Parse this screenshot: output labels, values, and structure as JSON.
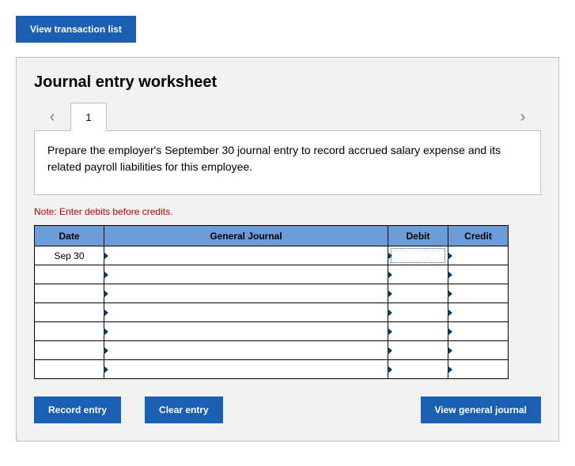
{
  "top_button": "View transaction list",
  "panel": {
    "title": "Journal entry worksheet",
    "tabs": [
      "1"
    ],
    "instruction": "Prepare the employer's September 30 journal entry to record accrued salary expense and its related payroll liabilities for this employee.",
    "note": "Note: Enter debits before credits."
  },
  "table": {
    "headers": {
      "date": "Date",
      "gj": "General Journal",
      "debit": "Debit",
      "credit": "Credit"
    },
    "rows": [
      {
        "date": "Sep 30",
        "gj": "",
        "debit": "",
        "credit": "",
        "focus": "debit"
      },
      {
        "date": "",
        "gj": "",
        "debit": "",
        "credit": ""
      },
      {
        "date": "",
        "gj": "",
        "debit": "",
        "credit": ""
      },
      {
        "date": "",
        "gj": "",
        "debit": "",
        "credit": ""
      },
      {
        "date": "",
        "gj": "",
        "debit": "",
        "credit": ""
      },
      {
        "date": "",
        "gj": "",
        "debit": "",
        "credit": ""
      },
      {
        "date": "",
        "gj": "",
        "debit": "",
        "credit": ""
      }
    ]
  },
  "buttons": {
    "record": "Record entry",
    "clear": "Clear entry",
    "view_gj": "View general journal"
  }
}
